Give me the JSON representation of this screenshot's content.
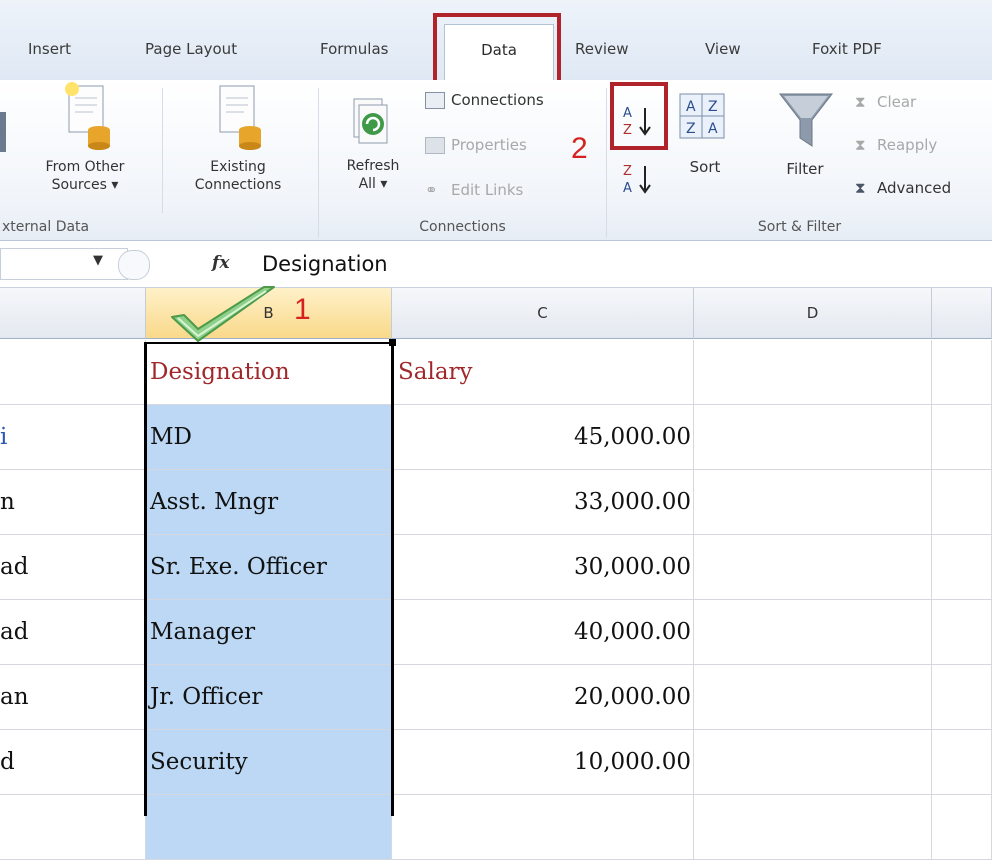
{
  "tabs": {
    "insert": "Insert",
    "page_layout": "Page Layout",
    "formulas": "Formulas",
    "data": "Data",
    "review": "Review",
    "view": "View",
    "foxit": "Foxit PDF"
  },
  "ribbon": {
    "from_other_1": "From Other",
    "from_other_2": "Sources ▾",
    "existing_1": "Existing",
    "existing_2": "Connections",
    "group_external": "xternal Data",
    "refresh_1": "Refresh",
    "refresh_2": "All ▾",
    "connections": "Connections",
    "properties": "Properties",
    "edit_links": "Edit Links",
    "group_connections": "Connections",
    "sort": "Sort",
    "filter": "Filter",
    "clear": "Clear",
    "reapply": "Reapply",
    "advanced": "Advanced",
    "group_sort_filter": "Sort & Filter"
  },
  "formula_bar": {
    "fx": "fx",
    "value": "Designation"
  },
  "columns": [
    "B",
    "C",
    "D"
  ],
  "annotations": {
    "step1": "1",
    "step2": "2"
  },
  "rows": [
    {
      "a": "",
      "b": "Designation",
      "c": "Salary"
    },
    {
      "a": "i",
      "b": "MD",
      "c": "45,000.00"
    },
    {
      "a": "n",
      "b": "Asst. Mngr",
      "c": "33,000.00"
    },
    {
      "a": "ad",
      "b": "Sr. Exe. Officer",
      "c": "30,000.00"
    },
    {
      "a": "ad",
      "b": "Manager",
      "c": "40,000.00"
    },
    {
      "a": "an",
      "b": "Jr. Officer",
      "c": "20,000.00"
    },
    {
      "a": "d",
      "b": "Security",
      "c": "10,000.00"
    }
  ],
  "colors": {
    "accent_red": "#b0232a",
    "selection_blue": "#bcd8f4",
    "header_text": "#a0282a"
  }
}
